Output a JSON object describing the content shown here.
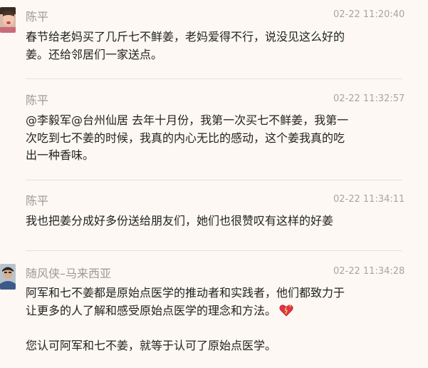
{
  "comments": [
    {
      "author": "陈平",
      "time": "02-22 11:20:40",
      "lines": [
        "春节给老妈买了几斤七不鲜姜，老妈爱得不行，说没见这么好的",
        "姜。还给邻居们一家送点。"
      ]
    },
    {
      "author": "陈平",
      "time": "02-22 11:32:57",
      "lines": [
        "@李毅军@台州仙居 去年十月份，我第一次买七不鲜姜，我第一",
        "次吃到七不姜的时候，我真的内心无比的感动，这个姜我真的吃",
        "出一种香味。"
      ]
    },
    {
      "author": "陈平",
      "time": "02-22 11:34:11",
      "lines": [
        "我也把姜分成好多份送给朋友们，她们也很赞叹有这样的好姜"
      ]
    },
    {
      "author": "随风侠–马来西亚",
      "time": "02-22 11:34:28",
      "lines": [
        "阿军和七不姜都是原始点医学的推动者和实践者，他们都致力于",
        "让更多的人了解和感受原始点医学的理念和方法。",
        "",
        "您认可阿军和七不姜，就等于认可了原始点医学。"
      ],
      "emoji": "sparkling-heart-icon"
    }
  ]
}
